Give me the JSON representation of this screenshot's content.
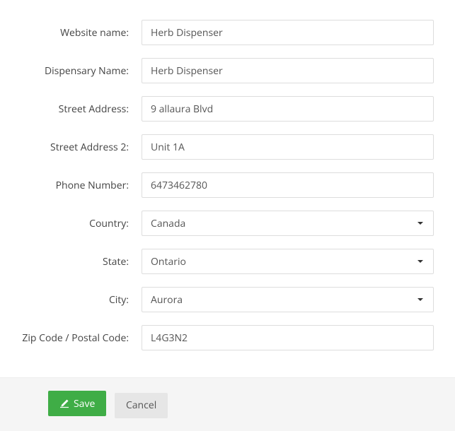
{
  "form": {
    "website_name": {
      "label": "Website name:",
      "value": "Herb Dispenser"
    },
    "dispensary_name": {
      "label": "Dispensary Name:",
      "value": "Herb Dispenser"
    },
    "street_address": {
      "label": "Street Address:",
      "value": "9 allaura Blvd"
    },
    "street_address_2": {
      "label": "Street Address 2:",
      "value": "Unit 1A"
    },
    "phone_number": {
      "label": "Phone Number:",
      "value": "6473462780"
    },
    "country": {
      "label": "Country:",
      "value": "Canada"
    },
    "state": {
      "label": "State:",
      "value": "Ontario"
    },
    "city": {
      "label": "City:",
      "value": "Aurora"
    },
    "zip_code": {
      "label": "Zip Code / Postal Code:",
      "value": "L4G3N2"
    }
  },
  "buttons": {
    "save": "Save",
    "cancel": "Cancel"
  }
}
